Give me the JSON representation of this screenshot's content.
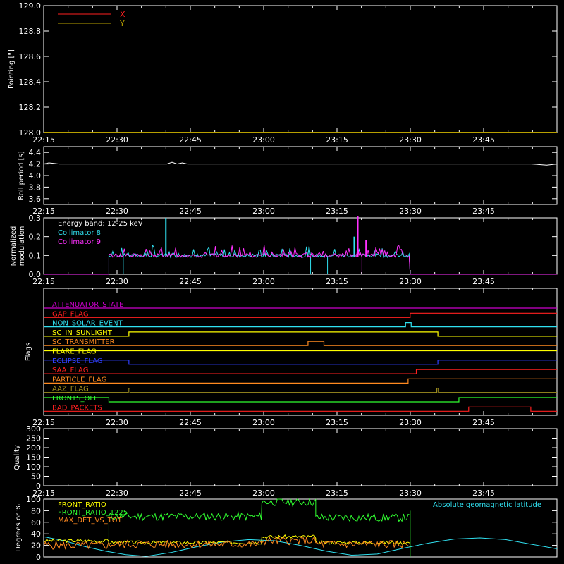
{
  "colors": {
    "background": "#000000",
    "axis": "#ffffff",
    "x": "#ff2020",
    "y": "#b8a000",
    "c8": "#30e0f0",
    "c9": "#ff30ff",
    "front_ratio": "#ffff00",
    "front_ratio_1225": "#30ff30",
    "max_det": "#ff8a20",
    "geomag": "#30e0f0"
  },
  "chart_data": [
    {
      "type": "line",
      "panel": "pointing",
      "ylabel": "Pointing [\"]",
      "ylim": [
        128.0,
        129.0
      ],
      "yticks": [
        "128.0",
        "128.2",
        "128.4",
        "128.6",
        "128.8",
        "129.0"
      ],
      "xticks": [
        "22:15",
        "22:30",
        "22:45",
        "23:00",
        "23:15",
        "23:30",
        "23:45"
      ],
      "legend": [
        {
          "name": "X",
          "color": "#ff2020"
        },
        {
          "name": "Y",
          "color": "#b8a000"
        }
      ],
      "legend_position": "top-left",
      "series": [
        {
          "name": "X",
          "x": [
            0,
            100
          ],
          "values": [
            128.0,
            128.0
          ]
        },
        {
          "name": "Y",
          "x": [
            0,
            100
          ],
          "values": [
            128.0,
            128.0
          ]
        }
      ]
    },
    {
      "type": "line",
      "panel": "roll",
      "ylabel": "Roll period [s]",
      "ylim": [
        3.5,
        4.5
      ],
      "yticks": [
        "3.6",
        "3.8",
        "4.0",
        "4.2",
        "4.4"
      ],
      "xticks": [
        "22:15",
        "22:30",
        "22:45",
        "23:00",
        "23:15",
        "23:30",
        "23:45"
      ],
      "series": [
        {
          "name": "roll",
          "x": [
            0,
            1,
            2,
            3,
            5,
            8,
            12,
            20,
            24,
            25,
            26,
            27,
            28,
            29,
            35,
            60,
            95,
            98,
            100
          ],
          "values": [
            4.2,
            4.22,
            4.21,
            4.2,
            4.2,
            4.2,
            4.2,
            4.2,
            4.2,
            4.23,
            4.2,
            4.22,
            4.2,
            4.2,
            4.2,
            4.2,
            4.2,
            4.18,
            4.2
          ]
        }
      ]
    },
    {
      "type": "line",
      "panel": "modulation",
      "ylabel": "Normalized modulation",
      "ylim": [
        0.0,
        0.3
      ],
      "yticks": [
        "0.0",
        "0.1",
        "0.2",
        "0.3"
      ],
      "xticks": [
        "22:15",
        "22:30",
        "22:45",
        "23:00",
        "23:15",
        "23:30",
        "23:45"
      ],
      "annotation": "Energy band: 12-25 keV",
      "legend": [
        {
          "name": "Collimator 8",
          "color": "#30e0f0"
        },
        {
          "name": "Collimator 9",
          "color": "#ff30ff"
        }
      ],
      "active_range": [
        12.7,
        71.4
      ],
      "baseline": 0.09,
      "c8_dips": [
        15.5,
        52.0,
        55.3
      ],
      "c9_dips": [
        62.0
      ],
      "c8_spikes": [
        {
          "x": 23.8,
          "v": 0.3
        },
        {
          "x": 60.5,
          "v": 0.2
        }
      ],
      "c9_spikes": [
        {
          "x": 61.2,
          "v": 0.31
        },
        {
          "x": 62.8,
          "v": 0.18
        }
      ]
    },
    {
      "type": "table",
      "panel": "flags",
      "ylabel": "Flags",
      "xticks": [
        "22:15",
        "22:30",
        "22:45",
        "23:00",
        "23:15",
        "23:30",
        "23:45"
      ],
      "flags": [
        {
          "name": "ATTENUATOR_STATE",
          "color": "#cc00cc",
          "segments": [
            [
              0,
              100,
              0
            ]
          ]
        },
        {
          "name": "GAP_FLAG",
          "color": "#ff2020",
          "segments": [
            [
              0,
              71.4,
              0
            ],
            [
              71.4,
              100,
              1
            ]
          ]
        },
        {
          "name": "NON_SOLAR_EVENT",
          "color": "#30e0f0",
          "segments": [
            [
              0,
              70.5,
              0
            ],
            [
              70.5,
              71.6,
              1
            ],
            [
              71.6,
              100,
              0
            ]
          ]
        },
        {
          "name": "SC_IN_SUNLIGHT",
          "color": "#ffff00",
          "segments": [
            [
              0,
              16.6,
              0
            ],
            [
              16.6,
              76.8,
              1
            ],
            [
              76.8,
              100,
              0
            ]
          ]
        },
        {
          "name": "SC_TRANSMITTER",
          "color": "#ff8a20",
          "segments": [
            [
              0,
              51.5,
              0
            ],
            [
              51.5,
              54.6,
              1
            ],
            [
              54.6,
              100,
              0
            ]
          ]
        },
        {
          "name": "FLARE_FLAG",
          "color": "#ffff00",
          "segments": [
            [
              0,
              100,
              1
            ]
          ]
        },
        {
          "name": "ECLIPSE_FLAG",
          "color": "#3040ff",
          "segments": [
            [
              0,
              16.6,
              1
            ],
            [
              16.6,
              76.8,
              0
            ],
            [
              76.8,
              100,
              1
            ]
          ]
        },
        {
          "name": "SAA_FLAG",
          "color": "#ff2020",
          "segments": [
            [
              0,
              72.6,
              0
            ],
            [
              72.6,
              100,
              1
            ]
          ]
        },
        {
          "name": "PARTICLE_FLAG",
          "color": "#ff8a20",
          "segments": [
            [
              0,
              71.0,
              0
            ],
            [
              71.0,
              71.7,
              1
            ],
            [
              71.7,
              100,
              1
            ]
          ]
        },
        {
          "name": "AAZ_FLAG",
          "color": "#a09020",
          "segments": [
            [
              0,
              16.5,
              0
            ],
            [
              16.5,
              16.8,
              1
            ],
            [
              16.8,
              76.6,
              0
            ],
            [
              76.6,
              76.9,
              1
            ],
            [
              76.9,
              100,
              0
            ]
          ]
        },
        {
          "name": "FRONTS_OFF",
          "color": "#30ff30",
          "segments": [
            [
              0,
              12.7,
              1
            ],
            [
              12.7,
              80.9,
              0
            ],
            [
              80.9,
              100,
              1
            ]
          ]
        },
        {
          "name": "BAD_PACKETS",
          "color": "#ff2020",
          "segments": [
            [
              0,
              82.8,
              0
            ],
            [
              82.8,
              94.9,
              1
            ],
            [
              94.9,
              100,
              0
            ]
          ]
        }
      ]
    },
    {
      "type": "line",
      "panel": "quality",
      "ylabel": "Quality",
      "ylim": [
        0,
        300
      ],
      "yticks": [
        "0",
        "50",
        "100",
        "150",
        "200",
        "250",
        "300"
      ],
      "xticks": [
        "22:15",
        "22:30",
        "22:45",
        "23:00",
        "23:15",
        "23:30",
        "23:45"
      ],
      "series": []
    },
    {
      "type": "line",
      "panel": "front_ratio",
      "ylabel": "Degrees or %",
      "ylim": [
        0,
        100
      ],
      "yticks": [
        "0",
        "20",
        "40",
        "60",
        "80",
        "100"
      ],
      "legend": [
        {
          "name": "FRONT_RATIO",
          "color": "#ffff00"
        },
        {
          "name": "FRONT_RATIO_1225",
          "color": "#30ff30"
        },
        {
          "name": "MAX_DET_VS_TOT",
          "color": "#ff8a20"
        }
      ],
      "legend_right": {
        "name": "Absolute geomagnetic latitude",
        "color": "#30e0f0"
      },
      "green_levels": [
        [
          12.7,
          42.5,
          70
        ],
        [
          42.5,
          53.0,
          95
        ],
        [
          53.0,
          71.4,
          68
        ]
      ],
      "yellow_levels": [
        [
          0,
          12.7,
          28
        ],
        [
          12.7,
          42.5,
          25
        ],
        [
          42.5,
          53.0,
          35
        ],
        [
          53.0,
          71.4,
          25
        ]
      ],
      "orange_levels": [
        [
          0,
          12.7,
          20
        ],
        [
          12.7,
          42.5,
          22
        ],
        [
          42.5,
          53.0,
          28
        ],
        [
          53.0,
          71.4,
          22
        ]
      ],
      "geomag": {
        "x": [
          0,
          4,
          8,
          12,
          16,
          20,
          25,
          30,
          35,
          40,
          45,
          50,
          55,
          60,
          65,
          70,
          75,
          80,
          85,
          90,
          95,
          100
        ],
        "values": [
          35,
          28,
          18,
          10,
          4,
          1,
          8,
          18,
          26,
          30,
          28,
          20,
          10,
          3,
          5,
          15,
          24,
          31,
          33,
          30,
          22,
          14
        ]
      }
    }
  ]
}
